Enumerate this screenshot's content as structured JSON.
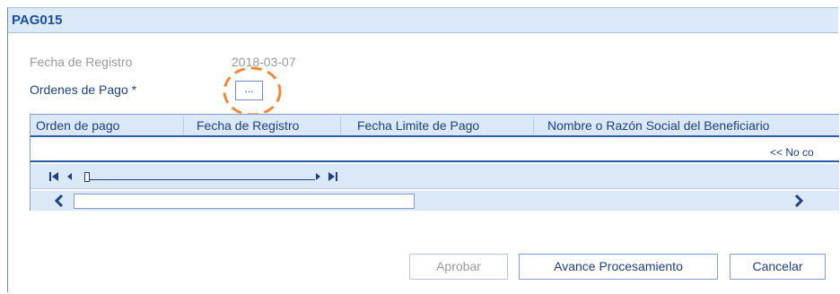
{
  "window": {
    "title": "PAG015"
  },
  "form": {
    "fecha_registro_label": "Fecha de Registro",
    "fecha_registro_value": "2018-03-07",
    "ordenes_label": "Ordenes de Pago *",
    "lookup_button_label": "..."
  },
  "table": {
    "columns": [
      {
        "label": "Orden de pago"
      },
      {
        "label": "Fecha de Registro"
      },
      {
        "label": "Fecha Limite de Pago"
      },
      {
        "label": "Nombre o Razón Social del Beneficiario"
      }
    ],
    "empty_message": "<< No co"
  },
  "pager_icons": [
    "first-page-icon",
    "prev-page-icon",
    "next-page-icon",
    "last-page-icon"
  ],
  "actions": {
    "aprobar": "Aprobar",
    "avance": "Avance Procesamiento",
    "cancelar": "Cancelar"
  },
  "colors": {
    "title_text": "#1b4f9c",
    "header_bg": "#dbe8f7",
    "highlight": "#f0893a",
    "accent_line": "#2a5aa8"
  }
}
